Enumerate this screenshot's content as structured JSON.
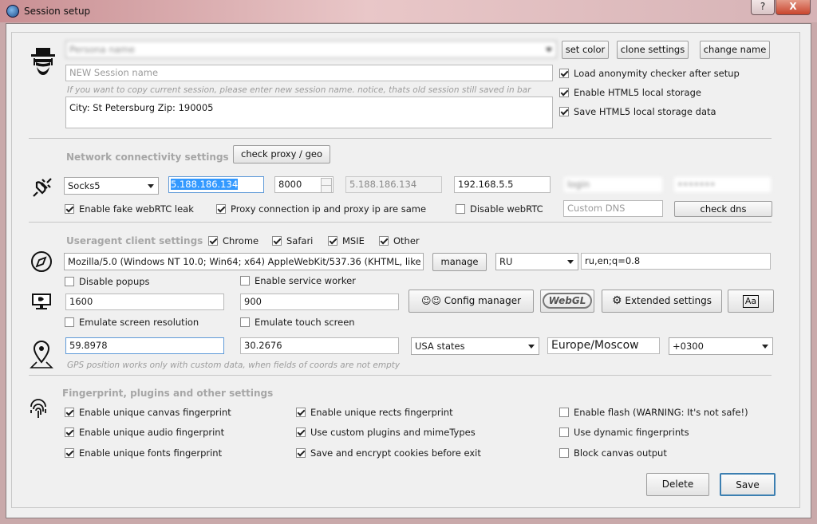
{
  "window": {
    "title": "Session setup",
    "help": "?",
    "close": "X"
  },
  "session": {
    "name_value": "Persona name",
    "set_color": "set color",
    "clone_settings": "clone settings",
    "change_name": "change name",
    "new_name_placeholder": "NEW Session name",
    "copy_hint": "If you want to copy current session, please enter new session name. notice, thats old session still saved in bar",
    "notes": "City: St Petersburg Zip: 190005",
    "load_checker": "Load anonymity checker after setup",
    "enable_html5": "Enable HTML5 local storage",
    "save_html5": "Save HTML5 local storage data"
  },
  "network": {
    "heading": "Network connectivity settings",
    "check_proxy": "check proxy / geo",
    "proxy_type": "Socks5",
    "proxy_ip": "5.188.186.134",
    "port": "8000",
    "external_ip": "5.188.186.134",
    "local_ip": "192.168.5.5",
    "login": "login",
    "password": "•••••••",
    "fake_webrtc": "Enable fake webRTC leak",
    "same_ip": "Proxy connection ip and proxy ip are same",
    "disable_webrtc": "Disable webRTC",
    "dns_placeholder": "Custom DNS",
    "check_dns": "check dns"
  },
  "useragent": {
    "heading": "Useragent client settings",
    "chrome": "Chrome",
    "safari": "Safari",
    "msie": "MSIE",
    "other": "Other",
    "ua_value": "Mozilla/5.0 (Windows NT 10.0; Win64; x64) AppleWebKit/537.36 (KHTML, like",
    "manage": "manage",
    "lang": "RU",
    "accept_lang": "ru,en;q=0.8",
    "disable_popups": "Disable popups",
    "service_worker": "Enable service worker",
    "width": "1600",
    "height": "900",
    "config_manager": "Config manager",
    "webgl": "WebGL",
    "extended": "Extended settings",
    "font_btn": "Aa",
    "emulate_resolution": "Emulate screen resolution",
    "emulate_touch": "Emulate touch screen"
  },
  "geo": {
    "lat": "59.8978",
    "lon": "30.2676",
    "region": "USA states",
    "timezone": "Europe/Moscow",
    "offset": "+0300",
    "hint": "GPS position works only with custom data, when fields of coords are not empty"
  },
  "fingerprint": {
    "heading": "Fingerprint, plugins and other settings",
    "canvas": "Enable unique canvas fingerprint",
    "audio": "Enable unique audio fingerprint",
    "fonts": "Enable unique fonts fingerprint",
    "rects": "Enable unique rects fingerprint",
    "plugins": "Use custom plugins and mimeTypes",
    "cookies": "Save and encrypt cookies before exit",
    "flash": "Enable flash (WARNING: It's not safe!)",
    "dynamic": "Use dynamic fingerprints",
    "block_canvas": "Block canvas output"
  },
  "footer": {
    "delete": "Delete",
    "save": "Save"
  },
  "icons": {
    "app": "browser-globe-icon",
    "person": "heisenberg-avatar-icon",
    "plug": "plug-icon",
    "compass": "compass-icon",
    "monitor": "monitor-icon",
    "pin": "location-pin-icon",
    "fingerprint": "fingerprint-icon",
    "people": "people-icon",
    "gear": "gear-icon",
    "font": "font-icon"
  },
  "colors": {
    "focus": "#5f9ad8",
    "selection": "#3399ff",
    "save_border": "#3c7fb1"
  }
}
